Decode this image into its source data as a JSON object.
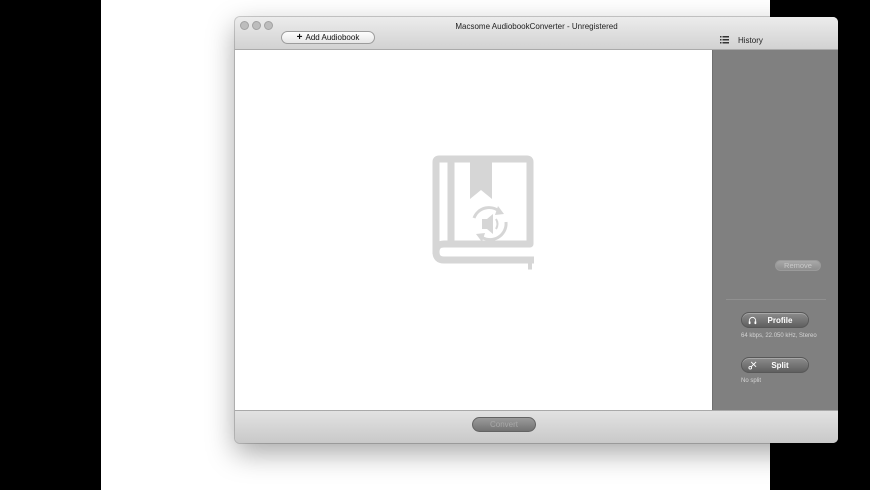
{
  "window": {
    "title": "Macsome AudiobookConverter - Unregistered"
  },
  "toolbar": {
    "add_label": "Add Audiobook",
    "add_icon": "plus-icon",
    "history_label": "History",
    "history_icon": "list-icon"
  },
  "main": {
    "placeholder_icon": "audiobook-icon"
  },
  "sidebar": {
    "remove_label": "Remove",
    "profile": {
      "label": "Profile",
      "icon": "headphones-icon",
      "info": "64  kbps, 22.050 kHz, Stereo"
    },
    "split": {
      "label": "Split",
      "icon": "scissors-icon",
      "info": "No split"
    }
  },
  "footer": {
    "convert_label": "Convert"
  },
  "colors": {
    "sidebar_bg": "#808080",
    "content_bg": "#ffffff",
    "icon_gray": "#d6d6d6"
  }
}
